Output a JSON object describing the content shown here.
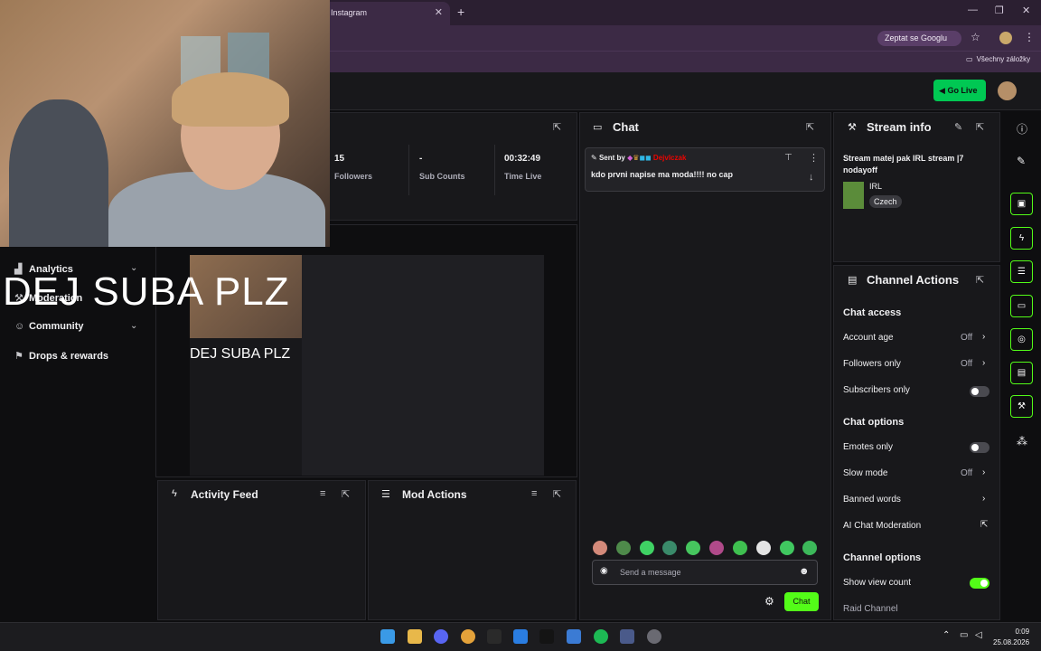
{
  "browser": {
    "tab_title": "Instagram",
    "google_button": "Zeptat se Googlu",
    "bookmarks_label": "Všechny záložky"
  },
  "header": {
    "go_live": "Go Live"
  },
  "sidebar": {
    "items": [
      {
        "label": "Analytics",
        "icon": "analytics-icon"
      },
      {
        "label": "Moderation",
        "icon": "wrench-icon"
      },
      {
        "label": "Community",
        "icon": "community-icon"
      },
      {
        "label": "Drops & rewards",
        "icon": "drops-icon"
      }
    ]
  },
  "stats": [
    {
      "value": "15",
      "label": "Followers"
    },
    {
      "value": "-",
      "label": "Sub Counts"
    },
    {
      "value": "00:32:49",
      "label": "Time Live"
    }
  ],
  "overlay": {
    "text": "DEJ SUBA PLZ",
    "preview_text": "DEJ SUBA PLZ"
  },
  "chat": {
    "title": "Chat",
    "sent_by": "Sent by",
    "username": "Dejvlczak",
    "message": "kdo prvni napise ma moda!!!! no cap",
    "input_placeholder": "Send a message",
    "send_button": "Chat"
  },
  "activity_feed": {
    "title": "Activity Feed"
  },
  "mod_actions": {
    "title": "Mod Actions"
  },
  "stream_info": {
    "title": "Stream info",
    "stream_title": "Stream matej pak IRL stream |7 nodayoff",
    "category": "IRL",
    "language": "Czech"
  },
  "channel_actions": {
    "title": "Channel Actions",
    "chat_access": {
      "heading": "Chat access",
      "account_age": {
        "label": "Account age",
        "value": "Off"
      },
      "followers_only": {
        "label": "Followers only",
        "value": "Off"
      },
      "subscribers_only": {
        "label": "Subscribers only",
        "enabled": false
      }
    },
    "chat_options": {
      "heading": "Chat options",
      "emotes_only": {
        "label": "Emotes only",
        "enabled": false
      },
      "slow_mode": {
        "label": "Slow mode",
        "value": "Off"
      },
      "banned_words": {
        "label": "Banned words"
      },
      "ai_moderation": {
        "label": "AI Chat Moderation"
      }
    },
    "channel_options": {
      "heading": "Channel options",
      "show_view_count": {
        "label": "Show view count",
        "enabled": true
      },
      "raid_channel": {
        "label": "Raid Channel"
      }
    }
  },
  "taskbar": {
    "time": "0:09",
    "date": "25.08.2026"
  },
  "colors": {
    "accent": "#53fc18",
    "golive": "#00c853",
    "username": "#eb0400",
    "background": "#0e0e10"
  }
}
